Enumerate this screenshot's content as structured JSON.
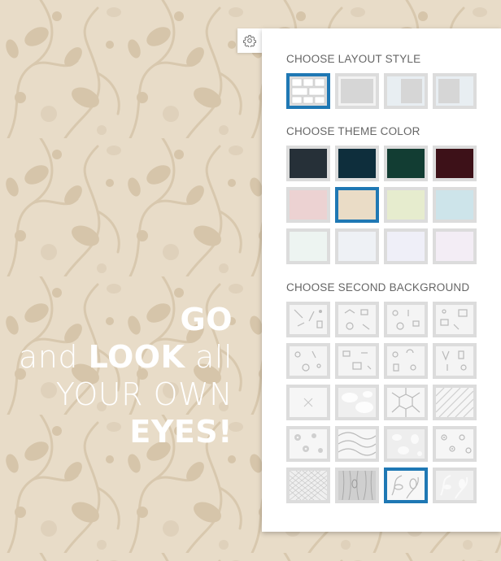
{
  "hero": {
    "line1_bold": "GO",
    "line2_pre": "and ",
    "line2_bold": "LOOK",
    "line2_post": " all",
    "line3": "YOUR OWN",
    "line4_bold": "EYES!"
  },
  "settings": {
    "toggle_icon": "gear-icon",
    "layout_heading": "CHOOSE LAYOUT STYLE",
    "layouts": [
      "boxed-grid",
      "full-width",
      "left-sidebar",
      "right-sidebar"
    ],
    "layout_selected": 0,
    "color_heading": "CHOOSE THEME COLOR",
    "colors": [
      "#263038",
      "#0e2e3c",
      "#123d33",
      "#3d1118",
      "#ecd2d2",
      "#eadcc6",
      "#e6ecce",
      "#cde4ea",
      "#edf4f1",
      "#eef1f5",
      "#efeff8",
      "#f3edf5"
    ],
    "color_selected": 5,
    "background_heading": "CHOOSE SECOND BACKGROUND",
    "backgrounds": [
      "tools",
      "travel",
      "food",
      "office",
      "party",
      "tech",
      "gadgets",
      "drinks",
      "cross",
      "floral-wash",
      "hexagon",
      "diagonal-lines",
      "daisies",
      "waves",
      "light-damask",
      "circles",
      "diamond-mesh",
      "wood",
      "blue-damask",
      "white-damask"
    ],
    "background_selected": 18
  },
  "colors": {
    "accent": "#1f78b4",
    "swatch_border": "#dcdcdc",
    "page_bg": "#e8dcc8"
  }
}
